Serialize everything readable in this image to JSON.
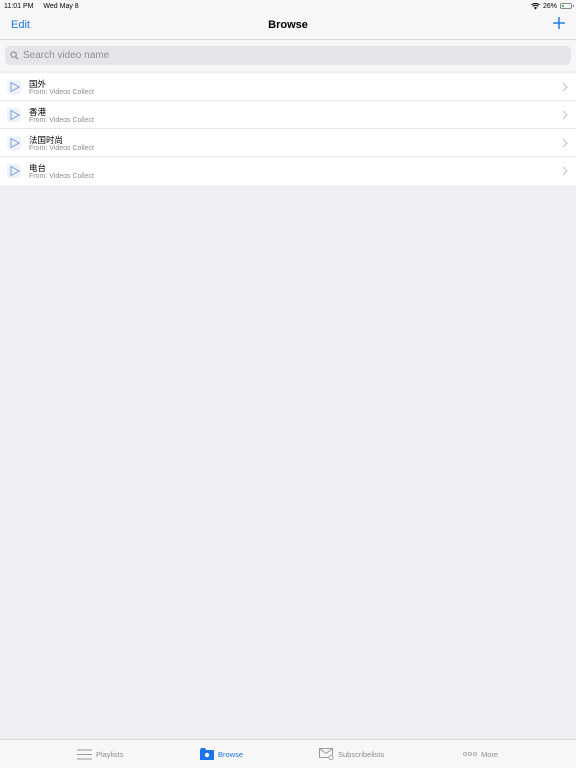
{
  "status": {
    "time": "11:01 PM",
    "date": "Wed May 8",
    "battery_percent": "26%",
    "battery_level": 0.26,
    "battery_color": "#34c759"
  },
  "nav": {
    "edit_label": "Edit",
    "title": "Browse",
    "add_icon": "plus-icon",
    "accent_color": "#1a73e8"
  },
  "search": {
    "placeholder": "Search video name",
    "value": ""
  },
  "list": {
    "items": [
      {
        "title": "国外",
        "subtitle": "From:  Videos Collect"
      },
      {
        "title": "香港",
        "subtitle": "From:  Videos Collect"
      },
      {
        "title": "法国时尚",
        "subtitle": "From:  Videos Collect"
      },
      {
        "title": "电台",
        "subtitle": "From:  Videos Collect"
      }
    ]
  },
  "tabs": [
    {
      "label": "Playlists",
      "icon": "list-lines-icon",
      "active": false
    },
    {
      "label": "Browse",
      "icon": "folder-icon",
      "active": true
    },
    {
      "label": "Subscribelists",
      "icon": "mail-icon",
      "active": false
    },
    {
      "label": "More",
      "icon": "more-dots-icon",
      "active": false
    }
  ]
}
